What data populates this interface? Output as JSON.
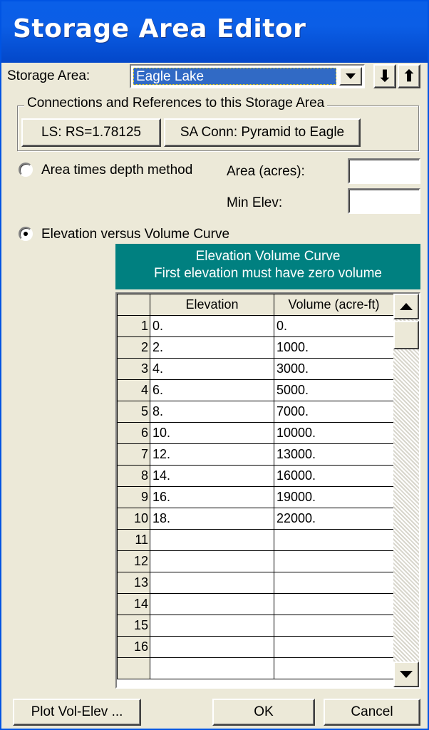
{
  "window": {
    "title": "Storage Area Editor"
  },
  "storage_area": {
    "label": "Storage Area:",
    "selected": "Eagle Lake",
    "down_arrow": "⬇",
    "up_arrow": "⬆"
  },
  "connections": {
    "title": "Connections and References to this Storage Area",
    "buttons": [
      "LS: RS=1.78125",
      "SA Conn: Pyramid to Eagle"
    ]
  },
  "area_method": {
    "label": "Area times depth method",
    "selected": false,
    "area_label": "Area (acres):",
    "area_value": "",
    "min_elev_label": "Min Elev:",
    "min_elev_value": ""
  },
  "elev_volume": {
    "label": "Elevation versus Volume Curve",
    "selected": true,
    "header_line1": "Elevation Volume Curve",
    "header_line2": "First elevation must have zero volume"
  },
  "table": {
    "columns": [
      "",
      "Elevation",
      "Volume (acre-ft)"
    ],
    "rows": [
      [
        "1",
        "0.",
        "0."
      ],
      [
        "2",
        "2.",
        "1000."
      ],
      [
        "3",
        "4.",
        "3000."
      ],
      [
        "4",
        "6.",
        "5000."
      ],
      [
        "5",
        "8.",
        "7000."
      ],
      [
        "6",
        "10.",
        "10000."
      ],
      [
        "7",
        "12.",
        "13000."
      ],
      [
        "8",
        "14.",
        "16000."
      ],
      [
        "9",
        "16.",
        "19000."
      ],
      [
        "10",
        "18.",
        "22000."
      ],
      [
        "11",
        "",
        ""
      ],
      [
        "12",
        "",
        ""
      ],
      [
        "13",
        "",
        ""
      ],
      [
        "14",
        "",
        ""
      ],
      [
        "15",
        "",
        ""
      ],
      [
        "16",
        "",
        ""
      ],
      [
        "",
        "",
        ""
      ]
    ]
  },
  "footer": {
    "plot_button": "Plot Vol-Elev ...",
    "ok_button": "OK",
    "cancel_button": "Cancel"
  },
  "colors": {
    "titlebar": "#0a5fe8",
    "header_bg": "#008080",
    "selection": "#316ac5",
    "window_bg": "#ece9d8"
  }
}
